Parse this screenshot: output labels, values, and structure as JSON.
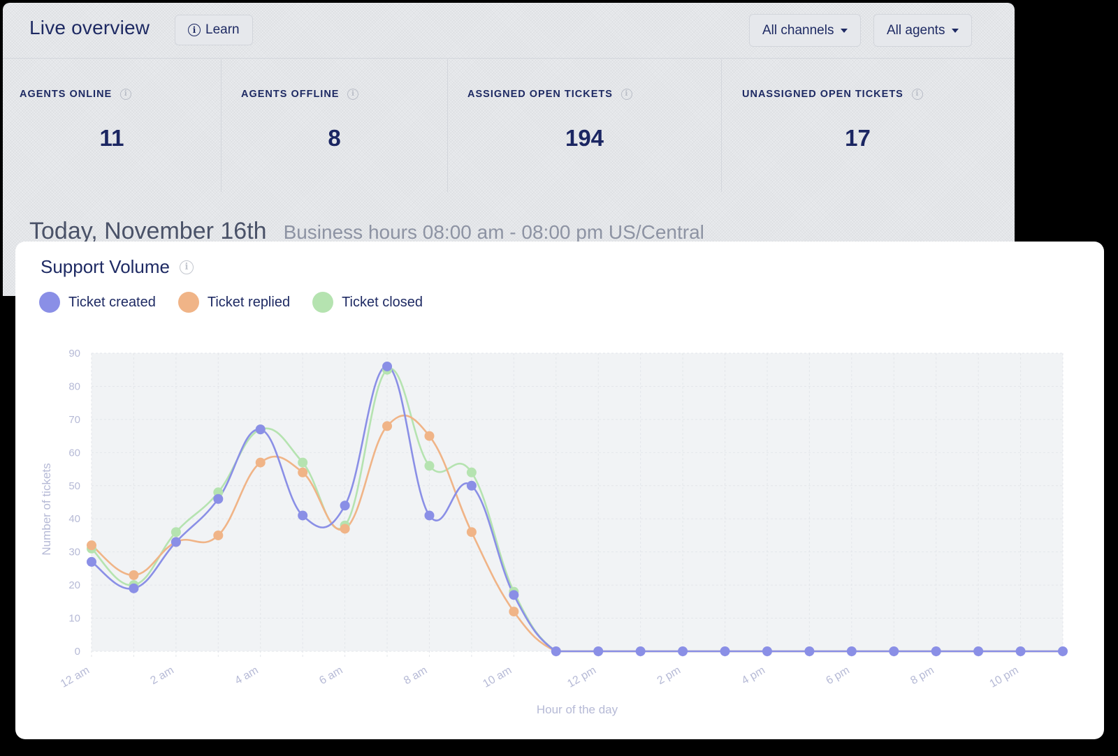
{
  "overview": {
    "title": "Live overview",
    "learn_label": "Learn",
    "filters": {
      "channels": "All channels",
      "agents": "All agents"
    },
    "stats": [
      {
        "label": "AGENTS ONLINE",
        "value": "11"
      },
      {
        "label": "AGENTS OFFLINE",
        "value": "8"
      },
      {
        "label": "ASSIGNED OPEN TICKETS",
        "value": "194"
      },
      {
        "label": "UNASSIGNED OPEN TICKETS",
        "value": "17"
      }
    ],
    "today": "Today, November 16th",
    "business_hours": "Business hours 08:00 am - 08:00 pm US/Central"
  },
  "card": {
    "title": "Support Volume"
  },
  "colors": {
    "created": "#8a8fe6",
    "replied": "#f0b487",
    "closed": "#b5e3b0"
  },
  "chart_data": {
    "type": "line",
    "ylabel": "Number of tickets",
    "xlabel": "Hour of the day",
    "ylim": [
      0,
      90
    ],
    "yticks": [
      0,
      10,
      20,
      30,
      40,
      50,
      60,
      70,
      80,
      90
    ],
    "x": [
      "12 am",
      "1 am",
      "2 am",
      "3 am",
      "4 am",
      "5 am",
      "6 am",
      "7 am",
      "8 am",
      "9 am",
      "10 am",
      "11 am",
      "12 pm",
      "1 pm",
      "2 pm",
      "3 pm",
      "4 pm",
      "5 pm",
      "6 pm",
      "7 pm",
      "8 pm",
      "9 pm",
      "10 pm",
      "11 pm"
    ],
    "xtick_labels": [
      "12 am",
      "2 am",
      "4 am",
      "6 am",
      "8 am",
      "10 am",
      "12 pm",
      "2 pm",
      "4 pm",
      "6 pm",
      "8 pm",
      "10 pm"
    ],
    "grid": true,
    "legend_position": "top-left",
    "series": [
      {
        "name": "Ticket closed",
        "color": "#b5e3b0",
        "values": [
          31,
          20,
          36,
          48,
          67,
          57,
          38,
          85,
          56,
          54,
          18,
          0,
          0,
          0,
          0,
          0,
          0,
          0,
          0,
          0,
          0,
          0,
          0,
          0
        ]
      },
      {
        "name": "Ticket replied",
        "color": "#f0b487",
        "values": [
          32,
          23,
          33,
          35,
          57,
          54,
          37,
          68,
          65,
          36,
          12,
          0,
          0,
          0,
          0,
          0,
          0,
          0,
          0,
          0,
          0,
          0,
          0,
          0
        ]
      },
      {
        "name": "Ticket created",
        "color": "#8a8fe6",
        "values": [
          27,
          19,
          33,
          46,
          67,
          41,
          44,
          86,
          41,
          50,
          17,
          0,
          0,
          0,
          0,
          0,
          0,
          0,
          0,
          0,
          0,
          0,
          0,
          0
        ]
      }
    ]
  }
}
